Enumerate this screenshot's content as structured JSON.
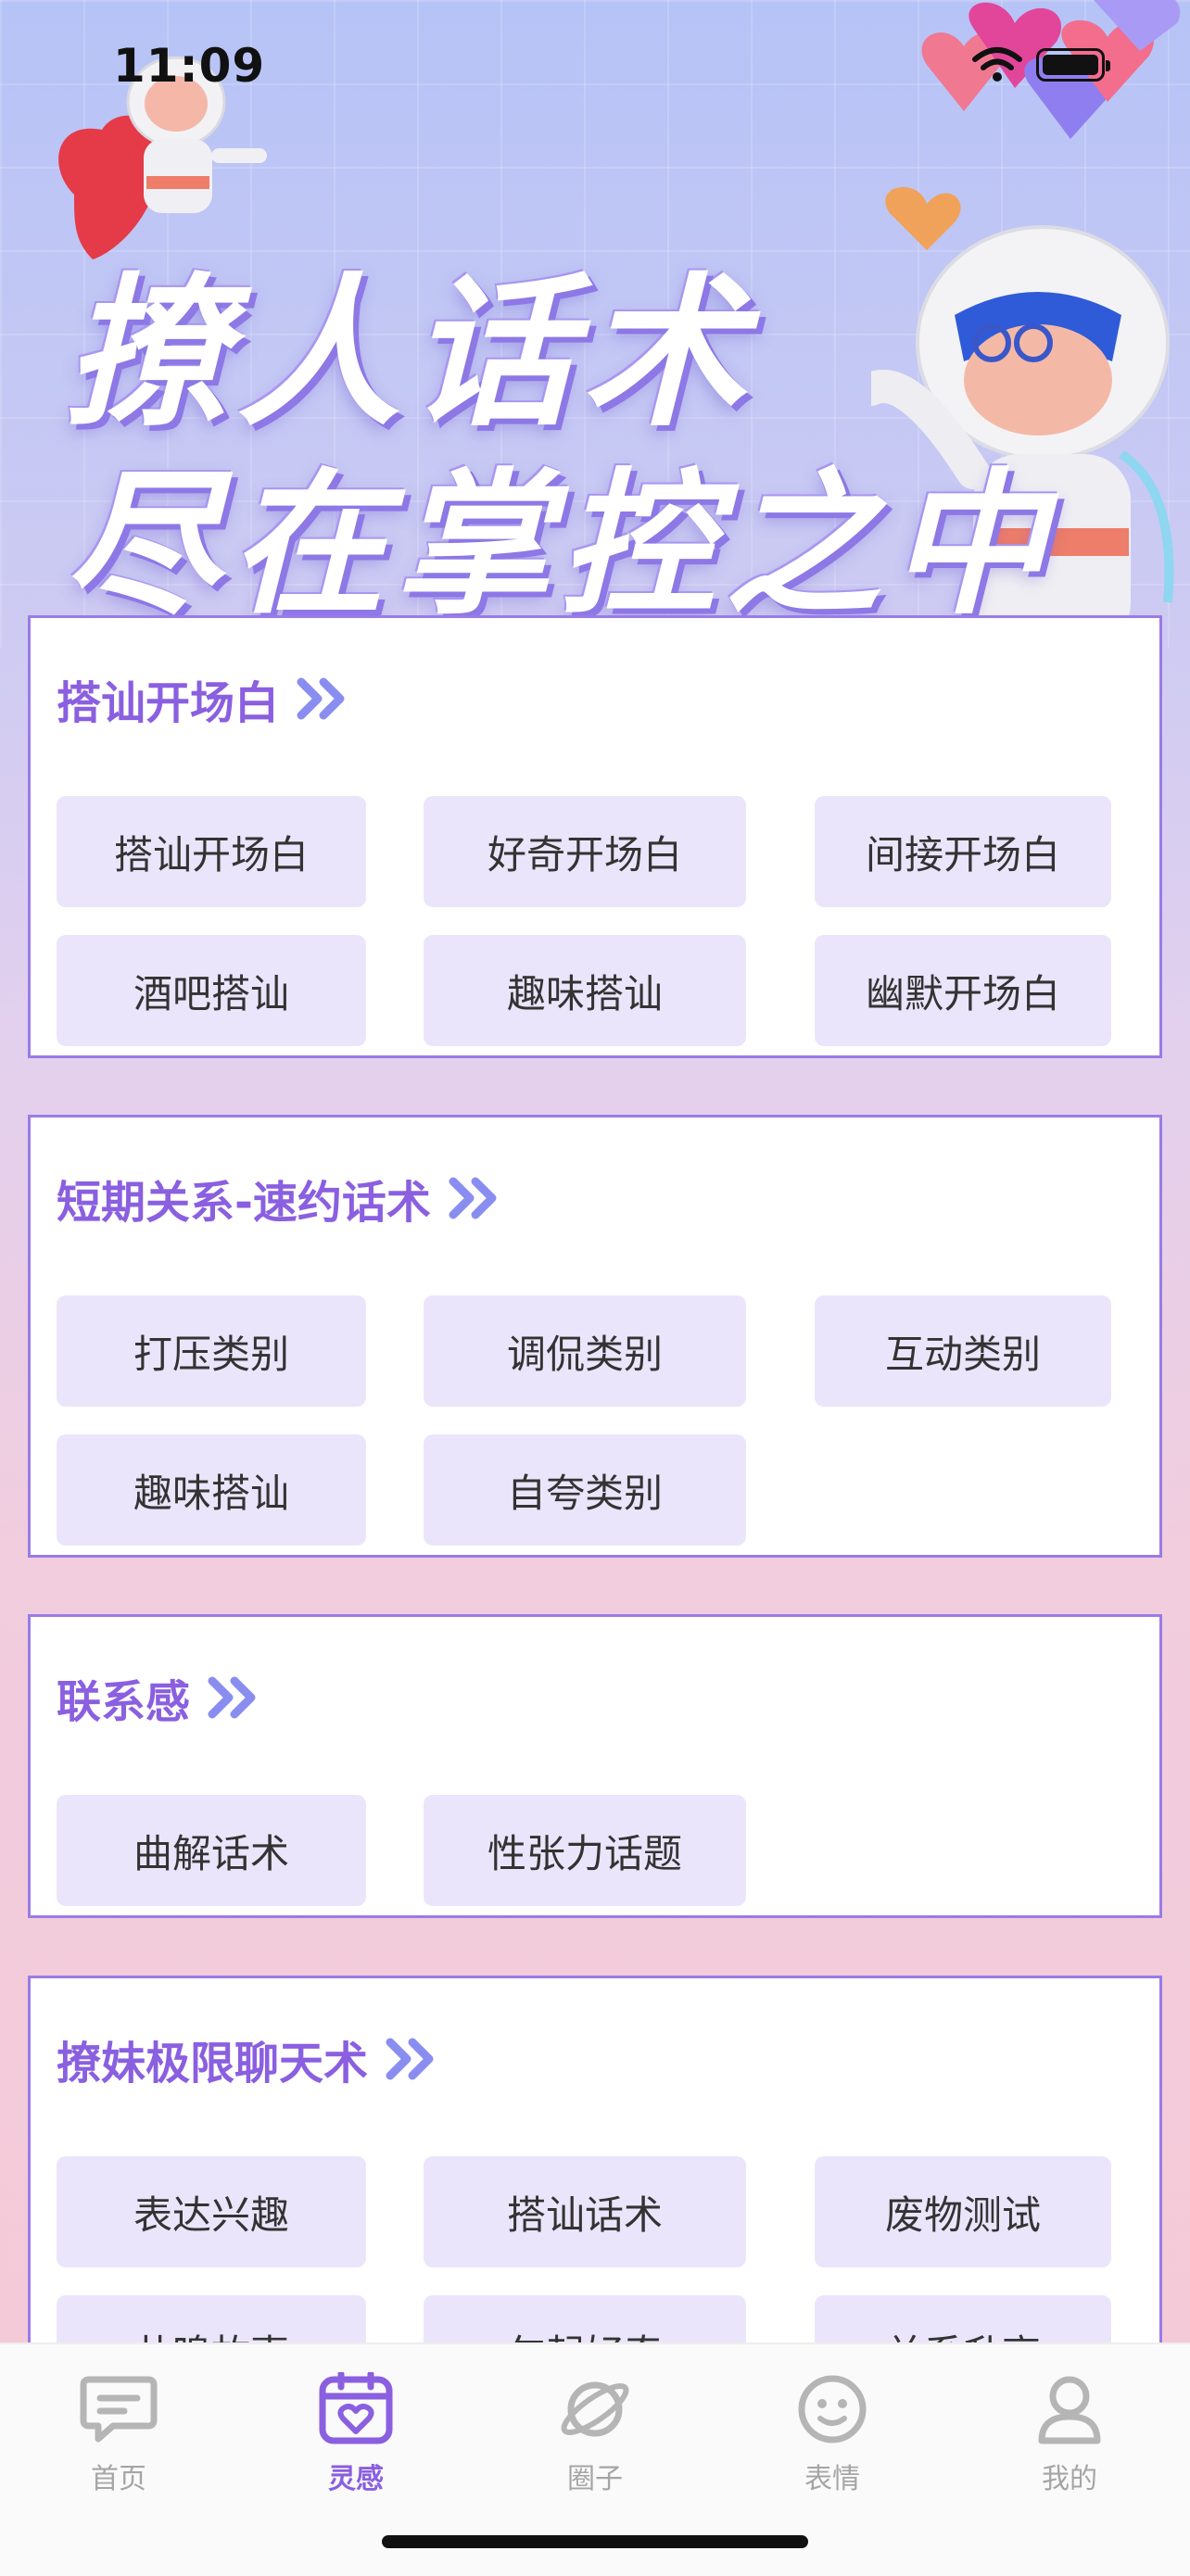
{
  "status_bar": {
    "time": "11:09"
  },
  "banner": {
    "line1": "撩人话术",
    "line2": "尽在掌控之中"
  },
  "sections": [
    {
      "title": "搭讪开场白",
      "items": [
        "搭讪开场白",
        "好奇开场白",
        "间接开场白",
        "酒吧搭讪",
        "趣味搭讪",
        "幽默开场白"
      ]
    },
    {
      "title": "短期关系-速约话术",
      "items": [
        "打压类别",
        "调侃类别",
        "互动类别",
        "趣味搭讪",
        "自夸类别"
      ]
    },
    {
      "title": "联系感",
      "items": [
        "曲解话术",
        "性张力话题"
      ]
    },
    {
      "title": "撩妹极限聊天术",
      "items": [
        "表达兴趣",
        "搭讪话术",
        "废物测试",
        "共鸣故事",
        "勾起好奇",
        "关系升高"
      ]
    }
  ],
  "tabbar": {
    "items": [
      {
        "label": "首页",
        "icon": "chat-bubble-icon",
        "active": false
      },
      {
        "label": "灵感",
        "icon": "calendar-heart-icon",
        "active": true
      },
      {
        "label": "圈子",
        "icon": "planet-icon",
        "active": false
      },
      {
        "label": "表情",
        "icon": "smiley-icon",
        "active": false
      },
      {
        "label": "我的",
        "icon": "person-icon",
        "active": false
      }
    ]
  },
  "colors": {
    "accent": "#8a5fe0",
    "chip_bg": "#ebe5fb",
    "border": "#9a7be8"
  }
}
